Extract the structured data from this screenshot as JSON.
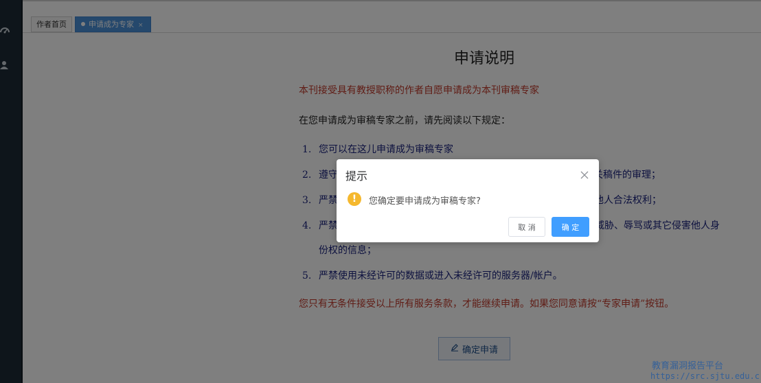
{
  "tabs": {
    "home": "作者首页",
    "active": "申请成为专家",
    "close_glyph": "×"
  },
  "content": {
    "title": "申请说明",
    "notice": "本刊接受具有教授职称的作者自愿申请成为本刊审稿专家",
    "intro": "在您申请成为审稿专家之前，请先阅读以下规定：",
    "rules": [
      {
        "num": "1.",
        "text": "您可以在这儿申请成为审稿专家"
      },
      {
        "num": "2.",
        "text": "遵守",
        "tail": "关稿件的审理；"
      },
      {
        "num": "3.",
        "text": "严禁",
        "tail": "他人合法权利；"
      },
      {
        "num": "4.",
        "text": "严禁",
        "tail": "威胁、辱骂或其它侵害他人身",
        "cont": "份权的信息；"
      },
      {
        "num": "5.",
        "text": "严禁使用未经许可的数据或进入未经许可的服务器/帐户。"
      }
    ],
    "footer_notice": "您只有无条件接受以上所有服务条款，才能继续申请。如果您同意请按“专家申请”按钮。",
    "apply_button": "确定申请"
  },
  "dialog": {
    "title": "提示",
    "message": "您确定要申请成为审稿专家?",
    "cancel": "取 消",
    "confirm": "确 定"
  },
  "watermark": {
    "line1": "教育漏洞报告平台",
    "line2": "https://src.sjtu.edu.c"
  },
  "colors": {
    "sidebar": "#1c2b36",
    "tab_active": "#4a90d9",
    "notice_red": "#c0392b",
    "rule_blue": "#1a237e",
    "confirm_blue": "#409eff",
    "warning": "#f5b82e"
  },
  "icons": {
    "sidebar": [
      "dashboard-icon",
      "user-icon"
    ],
    "dialog": [
      "close-icon",
      "warning-icon"
    ],
    "apply": "edit-icon"
  }
}
